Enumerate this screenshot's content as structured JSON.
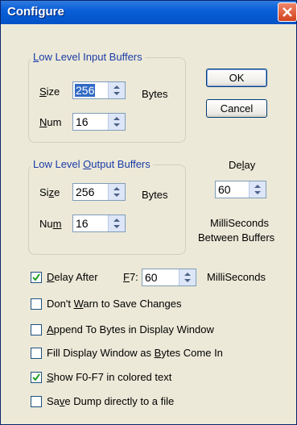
{
  "window": {
    "title": "Configure"
  },
  "input_group": {
    "legend_pre": "",
    "legend_ul": "L",
    "legend_post": "ow Level Input Buffers",
    "size": {
      "label_pre": "",
      "label_ul": "S",
      "label_post": "ize",
      "value": "256",
      "unit": "Bytes"
    },
    "num": {
      "label_pre": "",
      "label_ul": "N",
      "label_post": "um",
      "value": "16"
    }
  },
  "output_group": {
    "legend_pre": "Low Level ",
    "legend_ul": "O",
    "legend_post": "utput Buffers",
    "size": {
      "label_pre": "Si",
      "label_ul": "z",
      "label_post": "e",
      "value": "256",
      "unit": "Bytes"
    },
    "num": {
      "label_pre": "Nu",
      "label_ul": "m",
      "label_post": "",
      "value": "16"
    }
  },
  "buttons": {
    "ok": "OK",
    "cancel": "Cancel"
  },
  "delay": {
    "label_pre": "De",
    "label_ul": "l",
    "label_post": "ay",
    "value": "60",
    "unit_line1": "MilliSeconds",
    "unit_line2": "Between Buffers"
  },
  "options": [
    {
      "checked": true,
      "pre": "",
      "ul": "D",
      "post": "elay After"
    },
    {
      "checked": false,
      "pre": "Don't ",
      "ul": "W",
      "post": "arn to Save Changes"
    },
    {
      "checked": false,
      "pre": "",
      "ul": "A",
      "post": "ppend To Bytes in Display Window"
    },
    {
      "checked": false,
      "pre": "Fill Display Window as ",
      "ul": "B",
      "post": "ytes Come In"
    },
    {
      "checked": true,
      "pre": "",
      "ul": "S",
      "post": "how F0-F7 in colored text"
    },
    {
      "checked": false,
      "pre": "Sa",
      "ul": "v",
      "post": "e Dump directly to a file"
    }
  ],
  "delay_after": {
    "key_ul": "F",
    "key_post": "7:",
    "value": "60",
    "unit": "MilliSeconds"
  }
}
